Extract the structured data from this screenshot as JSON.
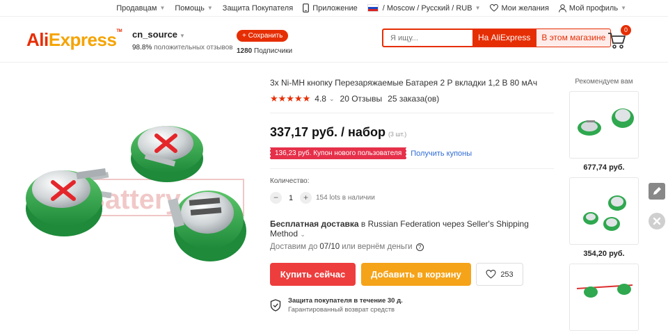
{
  "topbar": {
    "sellers": "Продавцам",
    "help": "Помощь",
    "buyer_protection": "Защита Покупателя",
    "app": "Приложение",
    "locale": "/ Moscow / Русский /  RUB",
    "wishlist": "Мои желания",
    "profile": "Мой профиль"
  },
  "header": {
    "logo_ali": "Ali",
    "logo_express": "Express",
    "store_name": "cn_source",
    "positive_pct": "98.8%",
    "positive_label": "положительных отзывов",
    "follow_label": "+ Сохранить",
    "subscribers_count": "1280",
    "subscribers_label": "Подписчики",
    "search_placeholder": "Я ищу...",
    "search_aliexpress": "На AliExpress",
    "search_store": "В этом магазине",
    "cart_count": "0"
  },
  "product": {
    "title": "3x Ni-MH кнопку Перезаряжаемые Батарея 2 Р вкладки 1,2 В 80 мАч",
    "rating_value": "4.8",
    "rating_stars": 4.8,
    "reviews": "20 Отзывы",
    "orders": "25 заказа(ов)",
    "price": "337,17 руб. / набор",
    "price_unit": "(3 шт.)",
    "coupon": "136,23 руб. Купон нового пользователя",
    "get_coupons": "Получить купоны",
    "quantity_label": "Количество:",
    "quantity_value": "1",
    "stock": "154 lots в наличии",
    "shipping_bold": "Бесплатная доставка",
    "shipping_rest": " в Russian Federation через Seller's Shipping Method",
    "deliver_prefix": "Доставим до",
    "deliver_date": "07/10",
    "deliver_suffix": "или вернём деньги",
    "buy_now": "Купить сейчас",
    "add_to_cart": "Добавить в корзину",
    "wish_count": "253",
    "protection_title": "Защита покупателя в течение 30 д.",
    "protection_sub": "Гарантированный возврат средств",
    "image_watermark": "Battery"
  },
  "recommendations": {
    "title": "Рекомендуем вам",
    "items": [
      {
        "price": "677,74 руб."
      },
      {
        "price": "354,20 руб."
      },
      {
        "price": ""
      }
    ]
  },
  "colors": {
    "accent": "#e62e04",
    "buy": "#ee3d3d",
    "cart": "#f5a319",
    "battery_green": "#2fa84f",
    "link": "#2e6bd6"
  }
}
